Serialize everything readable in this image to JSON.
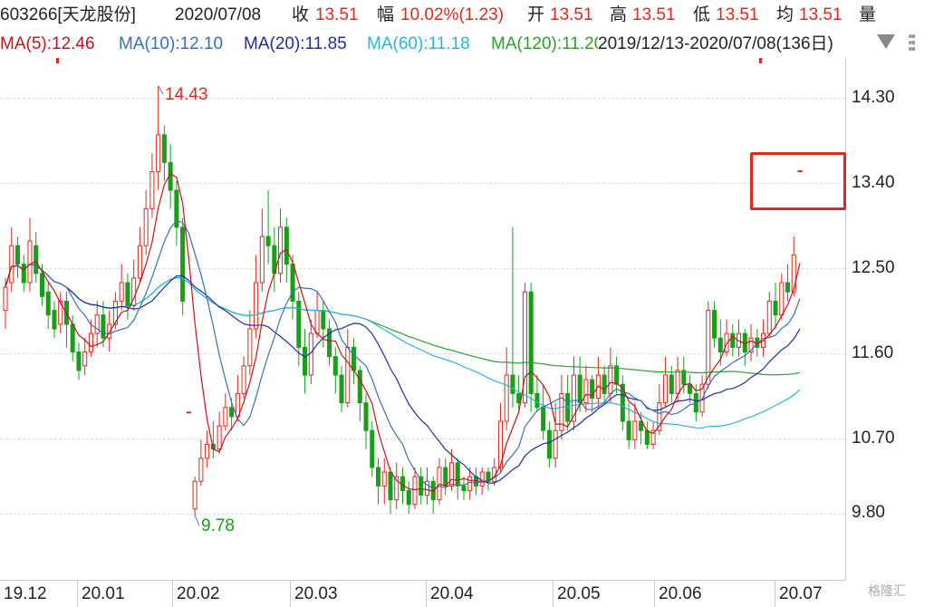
{
  "header": {
    "code_name": "603266[天龙股份]",
    "date": "2020/07/08",
    "close_label": "收",
    "close_value": "13.51",
    "change_label": "幅",
    "change_value": "10.02%(1.23)",
    "open_label": "开",
    "open_value": "13.51",
    "high_label": "高",
    "high_value": "13.51",
    "low_label": "低",
    "low_value": "13.51",
    "avg_label": "均",
    "avg_value": "13.51",
    "volume_label": "量"
  },
  "ma_bar": {
    "ma5": "MA(5):12.46",
    "ma10": "MA(10):12.10",
    "ma20": "MA(20):11.85",
    "ma60": "MA(60):11.18",
    "ma120": "MA(120):11.20",
    "range": "2019/12/13-2020/07/08(136日)"
  },
  "colors": {
    "up": "#e0281e",
    "down": "#1a9e1a",
    "ma5": "#c4141a",
    "ma10": "#3a6fb7",
    "ma20": "#1a2fa0",
    "ma60": "#2bb5d6",
    "ma120": "#2f9e2f"
  },
  "annotations": {
    "high_label": "14.43",
    "low_label": "9.78"
  },
  "chart_data": {
    "type": "candlestick",
    "y_ticks": [
      "14.30",
      "13.40",
      "12.50",
      "11.60",
      "10.70",
      "9.80"
    ],
    "x_ticks": [
      "19.12",
      "20.01",
      "20.02",
      "20.03",
      "20.04",
      "20.05",
      "20.06",
      "20.07"
    ],
    "ylim": [
      9.52,
      15.0
    ],
    "highest": 14.43,
    "lowest": 9.78,
    "last_close": 13.51,
    "candles_ohlc": [
      [
        12.0,
        12.25,
        11.8,
        12.35
      ],
      [
        12.3,
        12.7,
        12.2,
        12.9
      ],
      [
        12.7,
        12.5,
        12.35,
        12.8
      ],
      [
        12.5,
        12.3,
        12.2,
        12.6
      ],
      [
        12.3,
        12.75,
        12.2,
        13.0
      ],
      [
        12.7,
        12.4,
        12.3,
        12.85
      ],
      [
        12.4,
        12.15,
        12.05,
        12.5
      ],
      [
        12.2,
        11.95,
        11.8,
        12.3
      ],
      [
        12.0,
        11.8,
        11.7,
        12.1
      ],
      [
        11.85,
        12.1,
        11.75,
        12.2
      ],
      [
        12.1,
        11.85,
        11.6,
        12.2
      ],
      [
        11.85,
        11.55,
        11.45,
        11.95
      ],
      [
        11.55,
        11.35,
        11.25,
        11.65
      ],
      [
        11.4,
        11.55,
        11.3,
        11.7
      ],
      [
        11.55,
        11.75,
        11.5,
        11.9
      ],
      [
        11.75,
        11.95,
        11.6,
        12.1
      ],
      [
        11.95,
        11.7,
        11.6,
        12.1
      ],
      [
        11.7,
        11.85,
        11.55,
        12.0
      ],
      [
        11.85,
        12.1,
        11.8,
        12.2
      ],
      [
        12.1,
        12.3,
        12.0,
        12.5
      ],
      [
        12.3,
        12.05,
        11.9,
        12.4
      ],
      [
        12.05,
        12.35,
        12.0,
        12.55
      ],
      [
        12.35,
        12.7,
        12.3,
        12.9
      ],
      [
        12.7,
        13.1,
        12.6,
        13.3
      ],
      [
        13.1,
        13.5,
        13.0,
        13.7
      ],
      [
        13.5,
        13.9,
        13.3,
        14.43
      ],
      [
        13.9,
        13.6,
        13.4,
        14.0
      ],
      [
        13.6,
        13.3,
        13.1,
        13.8
      ],
      [
        13.3,
        12.9,
        12.7,
        13.4
      ],
      [
        12.9,
        12.1,
        11.95,
        13.0
      ],
      [
        10.9,
        10.9,
        10.9,
        10.9
      ],
      [
        9.85,
        10.15,
        9.78,
        10.2
      ],
      [
        10.15,
        10.4,
        10.1,
        10.6
      ],
      [
        10.4,
        10.55,
        10.3,
        10.7
      ],
      [
        10.55,
        10.5,
        10.4,
        10.8
      ],
      [
        10.5,
        10.75,
        10.45,
        10.9
      ],
      [
        10.75,
        10.95,
        10.7,
        11.1
      ],
      [
        10.95,
        10.85,
        10.7,
        11.05
      ],
      [
        10.85,
        11.1,
        10.8,
        11.3
      ],
      [
        11.1,
        11.4,
        11.05,
        11.5
      ],
      [
        11.4,
        11.8,
        11.3,
        12.0
      ],
      [
        11.8,
        12.3,
        11.7,
        12.6
      ],
      [
        12.3,
        12.8,
        12.2,
        13.1
      ],
      [
        12.8,
        12.7,
        12.5,
        13.3
      ],
      [
        12.7,
        12.4,
        12.2,
        12.9
      ],
      [
        12.4,
        12.9,
        12.3,
        13.1
      ],
      [
        12.9,
        12.5,
        12.3,
        13.0
      ],
      [
        12.5,
        12.1,
        11.9,
        12.6
      ],
      [
        12.1,
        11.6,
        11.4,
        12.2
      ],
      [
        11.6,
        11.3,
        11.1,
        11.8
      ],
      [
        11.3,
        11.75,
        11.2,
        11.9
      ],
      [
        11.75,
        12.0,
        11.7,
        12.2
      ],
      [
        12.0,
        11.8,
        11.6,
        12.1
      ],
      [
        11.8,
        11.5,
        11.4,
        11.9
      ],
      [
        11.5,
        11.3,
        11.1,
        11.6
      ],
      [
        11.3,
        11.0,
        10.9,
        11.4
      ],
      [
        11.0,
        11.6,
        10.95,
        11.8
      ],
      [
        11.6,
        11.35,
        11.2,
        11.7
      ],
      [
        11.35,
        11.0,
        10.8,
        11.4
      ],
      [
        11.0,
        10.7,
        10.5,
        11.1
      ],
      [
        10.7,
        10.3,
        10.2,
        10.8
      ],
      [
        10.3,
        10.1,
        9.9,
        10.4
      ],
      [
        10.1,
        10.25,
        9.9,
        10.4
      ],
      [
        10.25,
        9.95,
        9.8,
        10.3
      ],
      [
        9.95,
        10.2,
        9.85,
        10.35
      ],
      [
        10.2,
        10.05,
        9.9,
        10.3
      ],
      [
        10.05,
        9.9,
        9.8,
        10.15
      ],
      [
        9.9,
        10.2,
        9.85,
        10.3
      ],
      [
        10.2,
        10.0,
        9.9,
        10.3
      ],
      [
        10.0,
        10.15,
        9.9,
        10.3
      ],
      [
        10.15,
        9.95,
        9.8,
        10.2
      ],
      [
        9.95,
        10.3,
        9.9,
        10.4
      ],
      [
        10.3,
        10.1,
        10.0,
        10.4
      ],
      [
        10.1,
        10.35,
        10.05,
        10.5
      ],
      [
        10.35,
        10.1,
        9.95,
        10.4
      ],
      [
        10.1,
        10.05,
        9.95,
        10.2
      ],
      [
        10.05,
        10.2,
        9.95,
        10.3
      ],
      [
        10.2,
        10.1,
        10.0,
        10.3
      ],
      [
        10.1,
        10.25,
        10.0,
        10.3
      ],
      [
        10.25,
        10.15,
        10.05,
        10.3
      ],
      [
        10.15,
        10.3,
        10.1,
        10.4
      ],
      [
        10.3,
        10.8,
        10.25,
        11.0
      ],
      [
        10.8,
        11.3,
        10.7,
        11.6
      ],
      [
        11.3,
        11.1,
        10.95,
        12.9
      ],
      [
        11.1,
        11.0,
        10.9,
        11.3
      ],
      [
        11.0,
        12.2,
        10.95,
        12.3
      ],
      [
        12.2,
        11.1,
        10.9,
        12.3
      ],
      [
        11.1,
        10.95,
        10.9,
        11.3
      ],
      [
        10.95,
        10.7,
        10.6,
        11.2
      ],
      [
        10.7,
        10.4,
        10.3,
        10.8
      ],
      [
        10.4,
        10.7,
        10.3,
        11.0
      ],
      [
        10.7,
        11.1,
        10.6,
        11.3
      ],
      [
        11.1,
        10.8,
        10.7,
        11.3
      ],
      [
        10.8,
        11.3,
        10.7,
        11.5
      ],
      [
        11.3,
        11.0,
        10.9,
        11.5
      ],
      [
        11.0,
        11.25,
        10.9,
        11.4
      ],
      [
        11.25,
        11.05,
        10.9,
        11.3
      ],
      [
        11.05,
        11.3,
        10.95,
        11.5
      ],
      [
        11.3,
        11.1,
        11.0,
        11.4
      ],
      [
        11.1,
        11.4,
        11.0,
        11.6
      ],
      [
        11.4,
        11.2,
        11.1,
        11.5
      ],
      [
        11.2,
        10.8,
        10.7,
        11.3
      ],
      [
        10.8,
        10.6,
        10.5,
        11.0
      ],
      [
        10.6,
        10.8,
        10.5,
        11.0
      ],
      [
        10.8,
        10.7,
        10.55,
        10.9
      ],
      [
        10.7,
        10.55,
        10.5,
        10.8
      ],
      [
        10.55,
        10.7,
        10.5,
        10.8
      ],
      [
        10.7,
        11.0,
        10.65,
        11.2
      ],
      [
        11.0,
        11.3,
        10.95,
        11.5
      ],
      [
        11.3,
        11.1,
        11.0,
        11.4
      ],
      [
        11.1,
        11.35,
        11.0,
        11.5
      ],
      [
        11.35,
        11.2,
        11.1,
        11.5
      ],
      [
        11.2,
        11.1,
        11.0,
        11.3
      ],
      [
        11.1,
        10.9,
        10.8,
        11.2
      ],
      [
        10.9,
        11.2,
        10.85,
        11.3
      ],
      [
        11.2,
        12.0,
        11.15,
        12.1
      ],
      [
        12.0,
        11.7,
        11.6,
        12.1
      ],
      [
        11.7,
        11.55,
        11.4,
        11.9
      ],
      [
        11.55,
        11.75,
        11.5,
        11.9
      ],
      [
        11.75,
        11.6,
        11.5,
        11.85
      ],
      [
        11.6,
        11.75,
        11.5,
        11.9
      ],
      [
        11.75,
        11.55,
        11.4,
        11.8
      ],
      [
        11.55,
        11.7,
        11.45,
        11.85
      ],
      [
        11.7,
        11.6,
        11.5,
        11.8
      ],
      [
        11.6,
        11.75,
        11.5,
        11.9
      ],
      [
        11.75,
        12.1,
        11.7,
        12.2
      ],
      [
        12.1,
        11.95,
        11.8,
        12.3
      ],
      [
        11.95,
        12.3,
        11.9,
        12.4
      ],
      [
        12.3,
        12.2,
        12.1,
        12.5
      ],
      [
        12.2,
        12.6,
        12.15,
        12.8
      ],
      [
        13.51,
        13.51,
        13.51,
        13.51
      ]
    ],
    "ma_series_note": "moving averages drawn as smooth lines",
    "ma5_values": [
      12.3,
      12.4,
      12.45,
      12.4,
      12.35,
      12.2,
      12.05,
      11.9,
      11.8,
      11.75,
      11.7,
      11.7,
      11.75,
      11.85,
      12.0,
      12.3,
      12.7,
      13.1,
      13.5,
      13.6,
      13.4,
      12.6,
      11.4,
      10.5,
      10.2,
      10.4,
      10.7,
      11.0,
      11.6,
      12.2,
      12.6,
      12.7,
      12.5,
      12.1,
      11.8,
      11.6,
      11.5,
      11.3,
      11.2,
      10.9,
      10.5,
      10.2,
      10.1,
      10.05,
      10.0,
      10.1,
      10.1,
      10.15,
      10.2,
      10.15,
      10.5,
      11.0,
      11.1,
      11.0,
      10.9,
      10.9,
      11.0,
      11.1,
      11.15,
      11.2,
      11.0,
      10.7,
      10.7,
      10.9,
      11.2,
      11.2,
      11.3,
      11.6,
      11.6,
      11.7,
      11.7,
      11.75,
      11.9,
      12.1,
      12.4,
      12.46
    ]
  },
  "watermark": "格隆汇"
}
